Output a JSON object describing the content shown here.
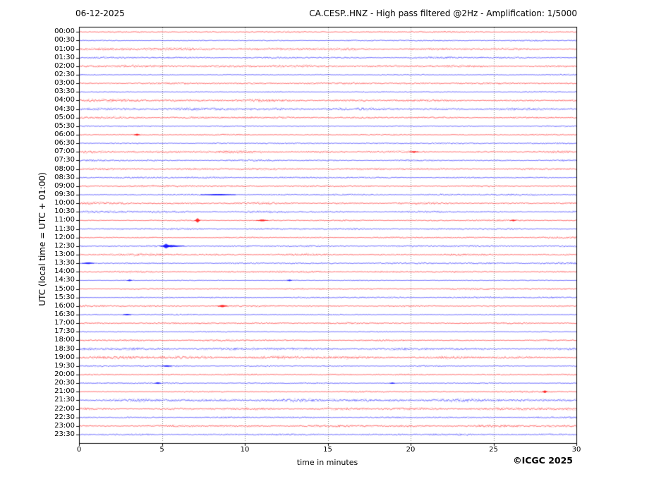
{
  "header": {
    "date": "06-12-2025",
    "title": "CA.CESP..HNZ - High pass filtered @2Hz - Amplification: 1/5000"
  },
  "axes": {
    "ylabel": "UTC (local time = UTC + 01:00)",
    "xlabel": "time in minutes"
  },
  "footer": {
    "copyright": "©ICGC 2025"
  },
  "chart_data": {
    "type": "line",
    "subtype": "helicorder-daily-seismogram",
    "title": "CA.CESP..HNZ - High pass filtered @2Hz - Amplification: 1/5000",
    "date": "06-12-2025",
    "xlabel": "time in minutes",
    "ylabel": "UTC (local time = UTC + 01:00)",
    "xlim": [
      0,
      30
    ],
    "x_ticks": [
      0,
      5,
      10,
      15,
      20,
      25,
      30
    ],
    "minutes_per_row": 30,
    "grid": "vertical-dotted-at-5min",
    "legend": "none",
    "colors": {
      "row_on_hour": "#ff0000",
      "row_on_half_hour": "#0000ff",
      "grid": "#8a8a8a",
      "frame": "#000000"
    },
    "rows": [
      {
        "time": "00:00",
        "color": "#ff0000",
        "noise": 0.7,
        "events": []
      },
      {
        "time": "00:30",
        "color": "#0000ff",
        "noise": 0.8,
        "events": []
      },
      {
        "time": "01:00",
        "color": "#ff0000",
        "noise": 1.3,
        "events": []
      },
      {
        "time": "01:30",
        "color": "#0000ff",
        "noise": 1.3,
        "events": []
      },
      {
        "time": "02:00",
        "color": "#ff0000",
        "noise": 1.1,
        "events": []
      },
      {
        "time": "02:30",
        "color": "#0000ff",
        "noise": 0.7,
        "events": []
      },
      {
        "time": "03:00",
        "color": "#ff0000",
        "noise": 0.9,
        "events": []
      },
      {
        "time": "03:30",
        "color": "#0000ff",
        "noise": 0.8,
        "events": []
      },
      {
        "time": "04:00",
        "color": "#ff0000",
        "noise": 1.3,
        "events": []
      },
      {
        "time": "04:30",
        "color": "#0000ff",
        "noise": 1.2,
        "events": []
      },
      {
        "time": "05:00",
        "color": "#ff0000",
        "noise": 1.0,
        "events": []
      },
      {
        "time": "05:30",
        "color": "#0000ff",
        "noise": 0.8,
        "events": []
      },
      {
        "time": "06:00",
        "color": "#ff0000",
        "noise": 0.9,
        "events": [
          {
            "minute": 3.5,
            "amp": 1.2,
            "sigma": 0.06
          }
        ]
      },
      {
        "time": "06:30",
        "color": "#0000ff",
        "noise": 0.7,
        "events": []
      },
      {
        "time": "07:00",
        "color": "#ff0000",
        "noise": 1.3,
        "events": [
          {
            "minute": 20.2,
            "amp": 0.8,
            "sigma": 0.1
          }
        ]
      },
      {
        "time": "07:30",
        "color": "#0000ff",
        "noise": 1.2,
        "events": []
      },
      {
        "time": "08:00",
        "color": "#ff0000",
        "noise": 0.9,
        "events": []
      },
      {
        "time": "08:30",
        "color": "#0000ff",
        "noise": 1.0,
        "events": []
      },
      {
        "time": "09:00",
        "color": "#ff0000",
        "noise": 0.8,
        "events": []
      },
      {
        "time": "09:30",
        "color": "#0000ff",
        "noise": 0.9,
        "events": [
          {
            "minute": 8.4,
            "amp": 0.8,
            "sigma": 0.35
          }
        ]
      },
      {
        "time": "10:00",
        "color": "#ff0000",
        "noise": 1.4,
        "events": []
      },
      {
        "time": "10:30",
        "color": "#0000ff",
        "noise": 1.2,
        "events": []
      },
      {
        "time": "11:00",
        "color": "#ff0000",
        "noise": 0.8,
        "events": [
          {
            "minute": 7.15,
            "amp": 3.2,
            "sigma": 0.06
          },
          {
            "minute": 11.05,
            "amp": 1.0,
            "sigma": 0.12
          },
          {
            "minute": 26.2,
            "amp": 0.8,
            "sigma": 0.06
          }
        ]
      },
      {
        "time": "11:30",
        "color": "#0000ff",
        "noise": 0.8,
        "events": []
      },
      {
        "time": "12:00",
        "color": "#ff0000",
        "noise": 0.9,
        "events": []
      },
      {
        "time": "12:30",
        "color": "#0000ff",
        "noise": 0.8,
        "events": [
          {
            "minute": 5.25,
            "amp": 3.2,
            "sigma": 0.1
          },
          {
            "minute": 5.6,
            "amp": 1.2,
            "sigma": 0.25
          }
        ]
      },
      {
        "time": "13:00",
        "color": "#ff0000",
        "noise": 1.3,
        "events": []
      },
      {
        "time": "13:30",
        "color": "#0000ff",
        "noise": 0.9,
        "events": [
          {
            "minute": 0.55,
            "amp": 1.0,
            "sigma": 0.12
          }
        ]
      },
      {
        "time": "14:00",
        "color": "#ff0000",
        "noise": 0.8,
        "events": []
      },
      {
        "time": "14:30",
        "color": "#0000ff",
        "noise": 0.7,
        "events": [
          {
            "minute": 3.05,
            "amp": 0.9,
            "sigma": 0.05
          },
          {
            "minute": 12.7,
            "amp": 0.8,
            "sigma": 0.05
          }
        ]
      },
      {
        "time": "15:00",
        "color": "#ff0000",
        "noise": 0.9,
        "events": []
      },
      {
        "time": "15:30",
        "color": "#0000ff",
        "noise": 0.9,
        "events": []
      },
      {
        "time": "16:00",
        "color": "#ff0000",
        "noise": 1.0,
        "events": [
          {
            "minute": 8.65,
            "amp": 1.5,
            "sigma": 0.1
          }
        ]
      },
      {
        "time": "16:30",
        "color": "#0000ff",
        "noise": 0.8,
        "events": [
          {
            "minute": 2.9,
            "amp": 0.7,
            "sigma": 0.08
          }
        ]
      },
      {
        "time": "17:00",
        "color": "#ff0000",
        "noise": 0.8,
        "events": []
      },
      {
        "time": "17:30",
        "color": "#0000ff",
        "noise": 0.7,
        "events": []
      },
      {
        "time": "18:00",
        "color": "#ff0000",
        "noise": 0.9,
        "events": []
      },
      {
        "time": "18:30",
        "color": "#0000ff",
        "noise": 1.2,
        "events": []
      },
      {
        "time": "19:00",
        "color": "#ff0000",
        "noise": 1.4,
        "events": []
      },
      {
        "time": "19:30",
        "color": "#0000ff",
        "noise": 0.9,
        "events": [
          {
            "minute": 5.3,
            "amp": 0.8,
            "sigma": 0.1
          }
        ]
      },
      {
        "time": "20:00",
        "color": "#ff0000",
        "noise": 0.7,
        "events": []
      },
      {
        "time": "20:30",
        "color": "#0000ff",
        "noise": 0.8,
        "events": [
          {
            "minute": 4.75,
            "amp": 0.9,
            "sigma": 0.06
          },
          {
            "minute": 18.9,
            "amp": 0.7,
            "sigma": 0.05
          }
        ]
      },
      {
        "time": "21:00",
        "color": "#ff0000",
        "noise": 0.8,
        "events": [
          {
            "minute": 28.1,
            "amp": 1.8,
            "sigma": 0.05
          }
        ]
      },
      {
        "time": "21:30",
        "color": "#0000ff",
        "noise": 1.4,
        "events": []
      },
      {
        "time": "22:00",
        "color": "#ff0000",
        "noise": 1.3,
        "events": []
      },
      {
        "time": "22:30",
        "color": "#0000ff",
        "noise": 0.8,
        "events": []
      },
      {
        "time": "23:00",
        "color": "#ff0000",
        "noise": 1.1,
        "events": []
      },
      {
        "time": "23:30",
        "color": "#0000ff",
        "noise": 0.9,
        "events": []
      }
    ]
  }
}
